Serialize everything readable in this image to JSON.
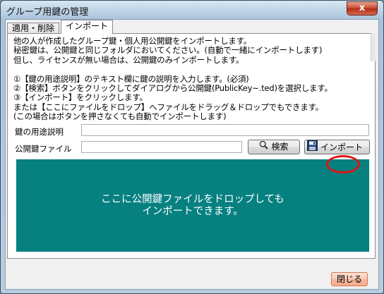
{
  "window": {
    "title": "グループ用鍵の管理",
    "close_glyph": "x"
  },
  "tabs": [
    {
      "label": "適用・削除",
      "active": false
    },
    {
      "label": "インポート",
      "active": true
    }
  ],
  "instructions": {
    "lines": [
      "他の人が作成したグループ鍵・個人用公開鍵をインポートします。",
      "秘密鍵は、公開鍵と同じフォルダにおいてください。(自動で一緒にインポートします)",
      "但し、ライセンスが無い場合は、公開鍵のみインポートします。",
      "",
      "①【鍵の用途説明】のテキスト欄に鍵の説明を入力します。(必須)",
      "②【検索】ボタンをクリックしてダイアログから公開鍵(PublicKey~.ted)を選択します。",
      "③【インポート】をクリックします。",
      "または【ここにファイルをドロップ】へファイルをドラッグ＆ドロップでもできます。",
      "(この場合はボタンを押さなくても自動でインポートします)"
    ]
  },
  "form": {
    "purpose_label": "鍵の用途説明",
    "purpose_value": "",
    "pubkey_label": "公開鍵ファイル",
    "pubkey_value": "",
    "search_button": "検索",
    "import_button": "インポート"
  },
  "dropzone": {
    "line1": "ここに公開鍵ファイルをドロップしても",
    "line2": "インポートできます。",
    "color": "#078080"
  },
  "footer": {
    "close_button": "閉じる"
  },
  "icons": [
    "close-icon",
    "search-icon",
    "floppy-disk-icon"
  ]
}
